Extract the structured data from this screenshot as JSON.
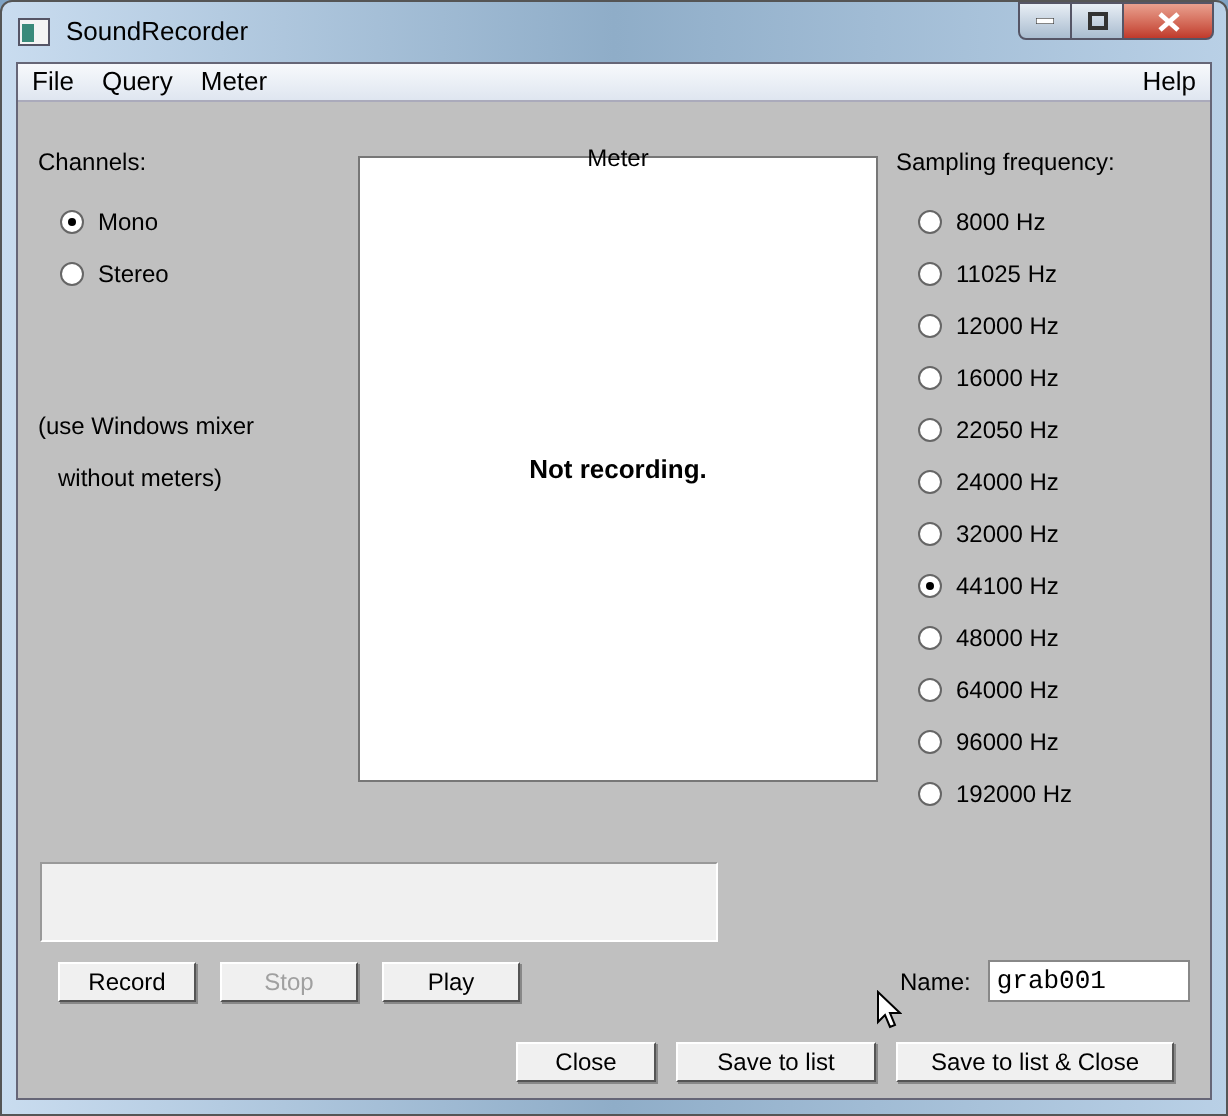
{
  "window": {
    "title": "SoundRecorder"
  },
  "menu": {
    "left": [
      "File",
      "Query",
      "Meter"
    ],
    "right": [
      "Help"
    ]
  },
  "channels": {
    "label": "Channels:",
    "options": [
      {
        "label": "Mono",
        "selected": true
      },
      {
        "label": "Stereo",
        "selected": false
      }
    ],
    "note": [
      "(use Windows mixer",
      "without meters)"
    ]
  },
  "meter": {
    "title": "Meter",
    "message": "Not recording."
  },
  "sampling": {
    "label": "Sampling frequency:",
    "options": [
      {
        "label": "8000 Hz",
        "selected": false
      },
      {
        "label": "11025 Hz",
        "selected": false
      },
      {
        "label": "12000 Hz",
        "selected": false
      },
      {
        "label": "16000 Hz",
        "selected": false
      },
      {
        "label": "22050 Hz",
        "selected": false
      },
      {
        "label": "24000 Hz",
        "selected": false
      },
      {
        "label": "32000 Hz",
        "selected": false
      },
      {
        "label": "44100 Hz",
        "selected": true
      },
      {
        "label": "48000 Hz",
        "selected": false
      },
      {
        "label": "64000 Hz",
        "selected": false
      },
      {
        "label": "96000 Hz",
        "selected": false
      },
      {
        "label": "192000 Hz",
        "selected": false
      }
    ]
  },
  "transport": [
    {
      "label": "Record",
      "disabled": false
    },
    {
      "label": "Stop",
      "disabled": true
    },
    {
      "label": "Play",
      "disabled": false
    }
  ],
  "name": {
    "label": "Name:",
    "value": "grab001"
  },
  "actions": [
    "Close",
    "Save to list",
    "Save to list & Close"
  ]
}
